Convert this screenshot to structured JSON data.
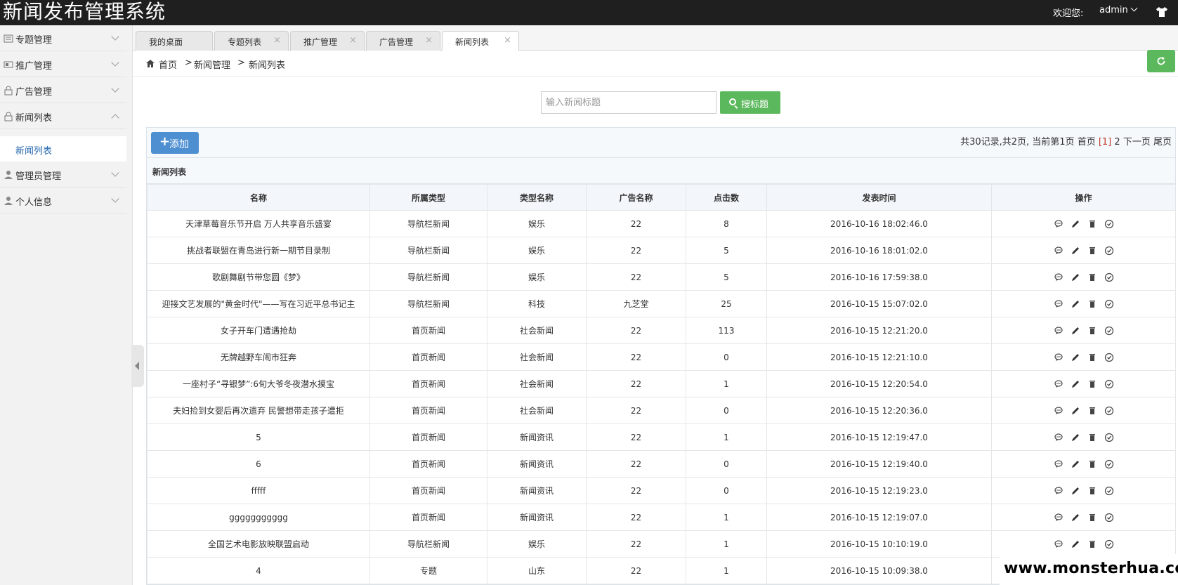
{
  "app": {
    "title": "新闻发布管理系统"
  },
  "header": {
    "welcome": "欢迎您:",
    "user": "admin"
  },
  "sidebar": {
    "items": [
      {
        "label": "专题管理"
      },
      {
        "label": "推广管理"
      },
      {
        "label": "广告管理"
      },
      {
        "label": "新闻列表"
      },
      {
        "label": "管理员管理"
      },
      {
        "label": "个人信息"
      }
    ],
    "sub_item": "新闻列表"
  },
  "tabs": [
    {
      "label": "我的桌面"
    },
    {
      "label": "专题列表"
    },
    {
      "label": "推广管理"
    },
    {
      "label": "广告管理"
    },
    {
      "label": "新闻列表"
    }
  ],
  "tab_close": "×",
  "breadcrumb": {
    "home": "首页",
    "sep": ">",
    "level1": "新闻管理",
    "level2": "新闻列表"
  },
  "search": {
    "placeholder": "输入新闻标题",
    "button": "搜标题"
  },
  "toolbar": {
    "add": "添加"
  },
  "pager": {
    "summary": "共30记录,共2页, 当前第1页",
    "first": "首页",
    "current": "[1]",
    "page2": "2",
    "next": "下一页",
    "last": "尾页"
  },
  "table": {
    "caption": "新闻列表",
    "columns": [
      "名称",
      "所属类型",
      "类型名称",
      "广告名称",
      "点击数",
      "发表时间",
      "操作"
    ],
    "rows": [
      [
        "天津草莓音乐节开启 万人共享音乐盛宴",
        "导航栏新闻",
        "娱乐",
        "22",
        "8",
        "2016-10-16 18:02:46.0"
      ],
      [
        "挑战者联盟在青岛进行新一期节目录制",
        "导航栏新闻",
        "娱乐",
        "22",
        "5",
        "2016-10-16 18:01:02.0"
      ],
      [
        "歌剧舞剧节带您圆《梦》",
        "导航栏新闻",
        "娱乐",
        "22",
        "5",
        "2016-10-16 17:59:38.0"
      ],
      [
        "迎接文艺发展的\"黄金时代\"——写在习近平总书记主",
        "导航栏新闻",
        "科技",
        "九芝堂",
        "25",
        "2016-10-15 15:07:02.0"
      ],
      [
        "女子开车门遭遇抢劫",
        "首页新闻",
        "社会新闻",
        "22",
        "113",
        "2016-10-15 12:21:20.0"
      ],
      [
        "无牌越野车闹市狂奔",
        "首页新闻",
        "社会新闻",
        "22",
        "0",
        "2016-10-15 12:21:10.0"
      ],
      [
        "一座村子“寻银梦”:6旬大爷冬夜潜水摸宝",
        "首页新闻",
        "社会新闻",
        "22",
        "1",
        "2016-10-15 12:20:54.0"
      ],
      [
        "夫妇捡到女婴后再次遗弃 民警想带走孩子遭拒",
        "首页新闻",
        "社会新闻",
        "22",
        "0",
        "2016-10-15 12:20:36.0"
      ],
      [
        "5",
        "首页新闻",
        "新闻资讯",
        "22",
        "1",
        "2016-10-15 12:19:47.0"
      ],
      [
        "6",
        "首页新闻",
        "新闻资讯",
        "22",
        "0",
        "2016-10-15 12:19:40.0"
      ],
      [
        "fffff",
        "首页新闻",
        "新闻资讯",
        "22",
        "0",
        "2016-10-15 12:19:23.0"
      ],
      [
        "ggggggggggg",
        "首页新闻",
        "新闻资讯",
        "22",
        "1",
        "2016-10-15 12:19:07.0"
      ],
      [
        "全国艺术电影放映联盟启动",
        "导航栏新闻",
        "娱乐",
        "22",
        "1",
        "2016-10-15 10:10:19.0"
      ],
      [
        "4",
        "专题",
        "山东",
        "22",
        "1",
        "2016-10-15 10:09:38.0"
      ]
    ]
  },
  "row_icons": [
    "comment-icon",
    "edit-icon",
    "delete-icon",
    "check-icon"
  ],
  "watermark": "www.monsterhua.com",
  "colors": {
    "topbar": "#1f1f1f",
    "green": "#5cb85c",
    "blue": "#4e8fd1",
    "current_page": "#c0392b"
  }
}
